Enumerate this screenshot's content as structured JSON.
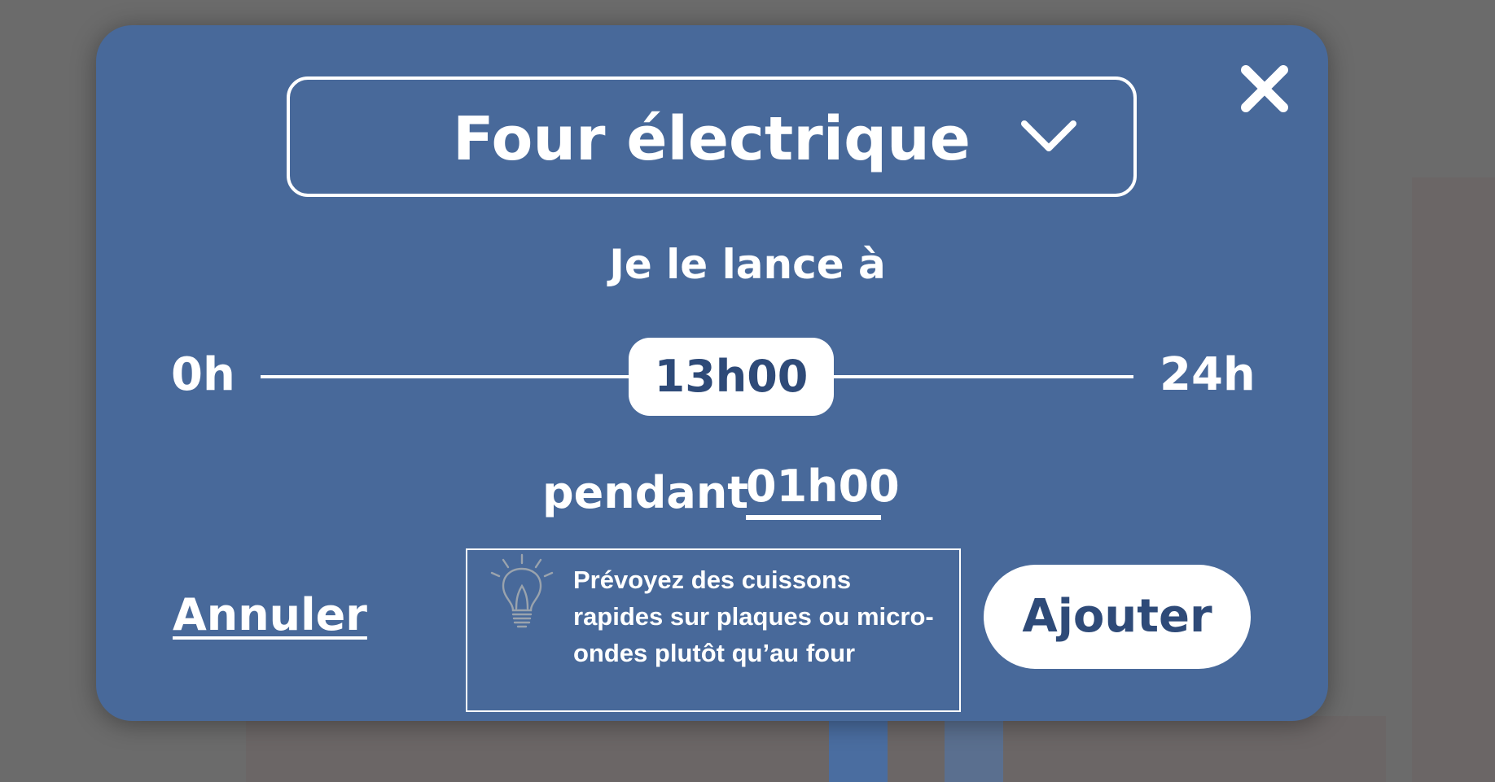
{
  "modal": {
    "device_select": {
      "value": "Four électrique"
    },
    "launch_label": "Je le lance à",
    "slider": {
      "min_label": "0h",
      "max_label": "24h",
      "value_label": "13h00",
      "value_hours": 13
    },
    "duration": {
      "label": "pendant",
      "value": "01h00"
    },
    "cancel_label": "Annuler",
    "tip": {
      "icon": "lightbulb-icon",
      "text": "Prévoyez des cuissons rapides sur plaques ou micro-ondes plutôt qu’au four"
    },
    "add_label": "Ajouter",
    "close_icon": "close-icon"
  },
  "colors": {
    "modal_background": "#48699a",
    "backdrop": "#6b6b6b",
    "button_text": "#2e4a78",
    "foreground": "#ffffff"
  }
}
